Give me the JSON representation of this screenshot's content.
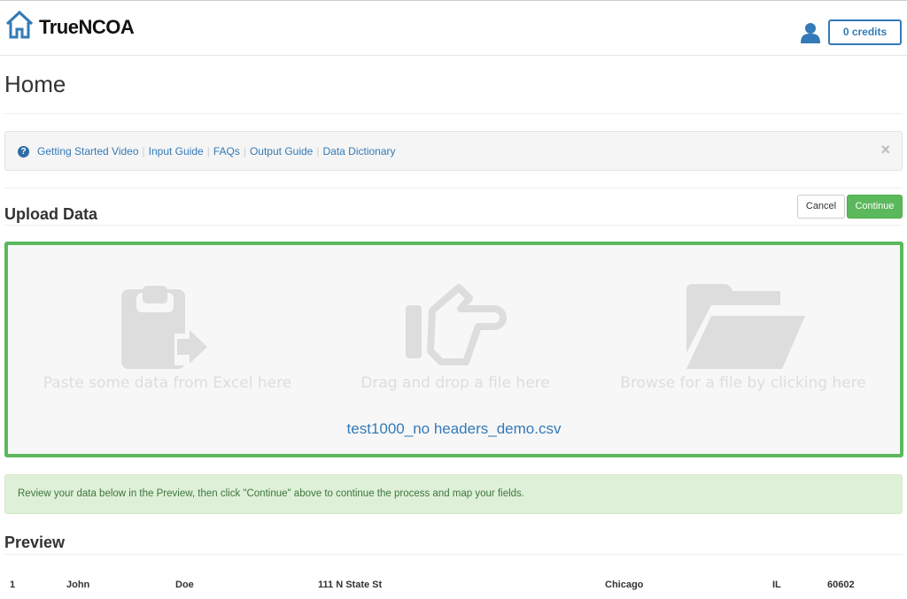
{
  "app": {
    "brand": "TrueNCOA",
    "credits_label": "0 credits"
  },
  "page": {
    "title": "Home"
  },
  "help": {
    "links": [
      "Getting Started Video",
      "Input Guide",
      "FAQs",
      "Output Guide",
      "Data Dictionary"
    ],
    "separator": "|",
    "close": "×"
  },
  "upload": {
    "title": "Upload Data",
    "cancel_label": "Cancel",
    "continue_label": "Continue",
    "options": [
      {
        "icon": "clipboard-paste-icon",
        "label": "Paste some data from Excel here"
      },
      {
        "icon": "pointing-hand-icon",
        "label": "Drag and drop a file here"
      },
      {
        "icon": "folder-open-icon",
        "label": "Browse for a file by clicking here"
      }
    ],
    "selected_file": "test1000_no headers_demo.csv"
  },
  "alert": {
    "message": "Review your data below in the Preview, then click \"Continue\" above to continue the process and map your fields."
  },
  "preview": {
    "title": "Preview",
    "rows": [
      [
        "1",
        "John",
        "Doe",
        "111 N State St",
        "Chicago",
        "IL",
        "60602"
      ]
    ]
  },
  "colors": {
    "brand_blue": "#337ab7",
    "success_green": "#5cb85c",
    "alert_bg": "#dff0d8",
    "alert_text": "#3c763d"
  }
}
